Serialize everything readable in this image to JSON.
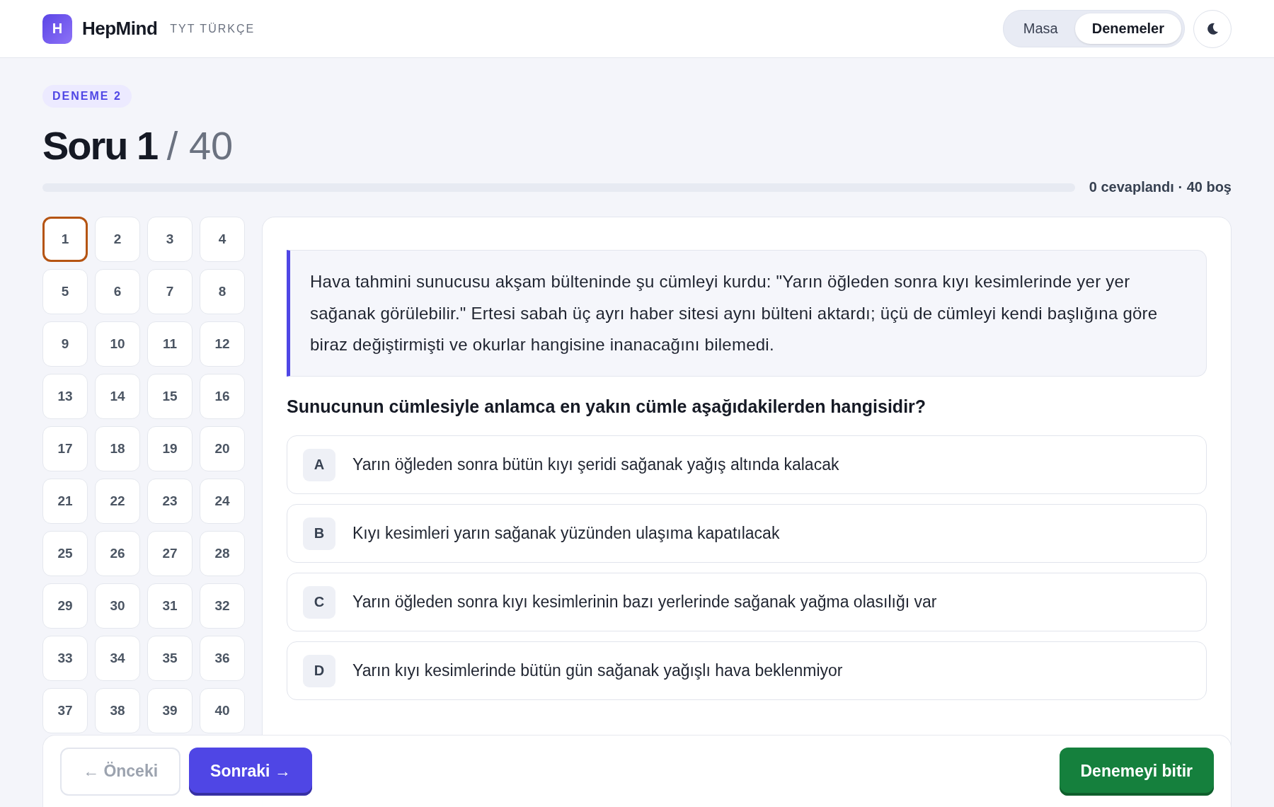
{
  "header": {
    "logo_letter": "H",
    "brand": "HepMind",
    "subtitle": "TYT TÜRKÇE",
    "nav": [
      {
        "label": "Masa",
        "selected": false
      },
      {
        "label": "Denemeler",
        "selected": true
      }
    ]
  },
  "badge": "DENEME 2",
  "title": {
    "current": "Soru 1",
    "total": "/ 40"
  },
  "progress": {
    "summary": "0 cevaplandı · 40 boş"
  },
  "question_grid": [
    {
      "label": "1",
      "selected": true
    },
    {
      "label": "2",
      "selected": false
    },
    {
      "label": "3",
      "selected": false
    },
    {
      "label": "4",
      "selected": false
    },
    {
      "label": "5",
      "selected": false
    },
    {
      "label": "6",
      "selected": false
    },
    {
      "label": "7",
      "selected": false
    },
    {
      "label": "8",
      "selected": false
    },
    {
      "label": "9",
      "selected": false
    },
    {
      "label": "10",
      "selected": false
    },
    {
      "label": "11",
      "selected": false
    },
    {
      "label": "12",
      "selected": false
    },
    {
      "label": "13",
      "selected": false
    },
    {
      "label": "14",
      "selected": false
    },
    {
      "label": "15",
      "selected": false
    },
    {
      "label": "16",
      "selected": false
    },
    {
      "label": "17",
      "selected": false
    },
    {
      "label": "18",
      "selected": false
    },
    {
      "label": "19",
      "selected": false
    },
    {
      "label": "20",
      "selected": false
    },
    {
      "label": "21",
      "selected": false
    },
    {
      "label": "22",
      "selected": false
    },
    {
      "label": "23",
      "selected": false
    },
    {
      "label": "24",
      "selected": false
    },
    {
      "label": "25",
      "selected": false
    },
    {
      "label": "26",
      "selected": false
    },
    {
      "label": "27",
      "selected": false
    },
    {
      "label": "28",
      "selected": false
    },
    {
      "label": "29",
      "selected": false
    },
    {
      "label": "30",
      "selected": false
    },
    {
      "label": "31",
      "selected": false
    },
    {
      "label": "32",
      "selected": false
    },
    {
      "label": "33",
      "selected": false
    },
    {
      "label": "34",
      "selected": false
    },
    {
      "label": "35",
      "selected": false
    },
    {
      "label": "36",
      "selected": false
    },
    {
      "label": "37",
      "selected": false
    },
    {
      "label": "38",
      "selected": false
    },
    {
      "label": "39",
      "selected": false
    },
    {
      "label": "40",
      "selected": false
    }
  ],
  "passage": "Hava tahmini sunucusu akşam bülteninde şu cümleyi kurdu: \"Yarın öğleden sonra kıyı kesimlerinde yer yer sağanak görülebilir.\" Ertesi sabah üç ayrı haber sitesi aynı bülteni aktardı; üçü de cümleyi kendi başlığına göre biraz değiştirmişti ve okurlar hangisine inanacağını bilemedi.",
  "prompt": "Sunucunun cümlesiyle anlamca en yakın cümle aşağıdakilerden hangisidir?",
  "options": [
    {
      "letter": "A",
      "text": "Yarın öğleden sonra bütün kıyı şeridi sağanak yağış altında kalacak",
      "selected": false
    },
    {
      "letter": "B",
      "text": "Kıyı kesimleri yarın sağanak yüzünden ulaşıma kapatılacak",
      "selected": false
    },
    {
      "letter": "C",
      "text": "Yarın öğleden sonra kıyı kesimlerinin bazı yerlerinde sağanak yağma olasılığı var",
      "selected": false
    },
    {
      "letter": "D",
      "text": "Yarın kıyı kesimlerinde bütün gün sağanak yağışlı hava beklenmiyor",
      "selected": false
    }
  ],
  "footer": {
    "prev": "← Önceki",
    "prev_disabled": true,
    "next": "Sonraki →",
    "finish": "Denemeyi bitir"
  }
}
